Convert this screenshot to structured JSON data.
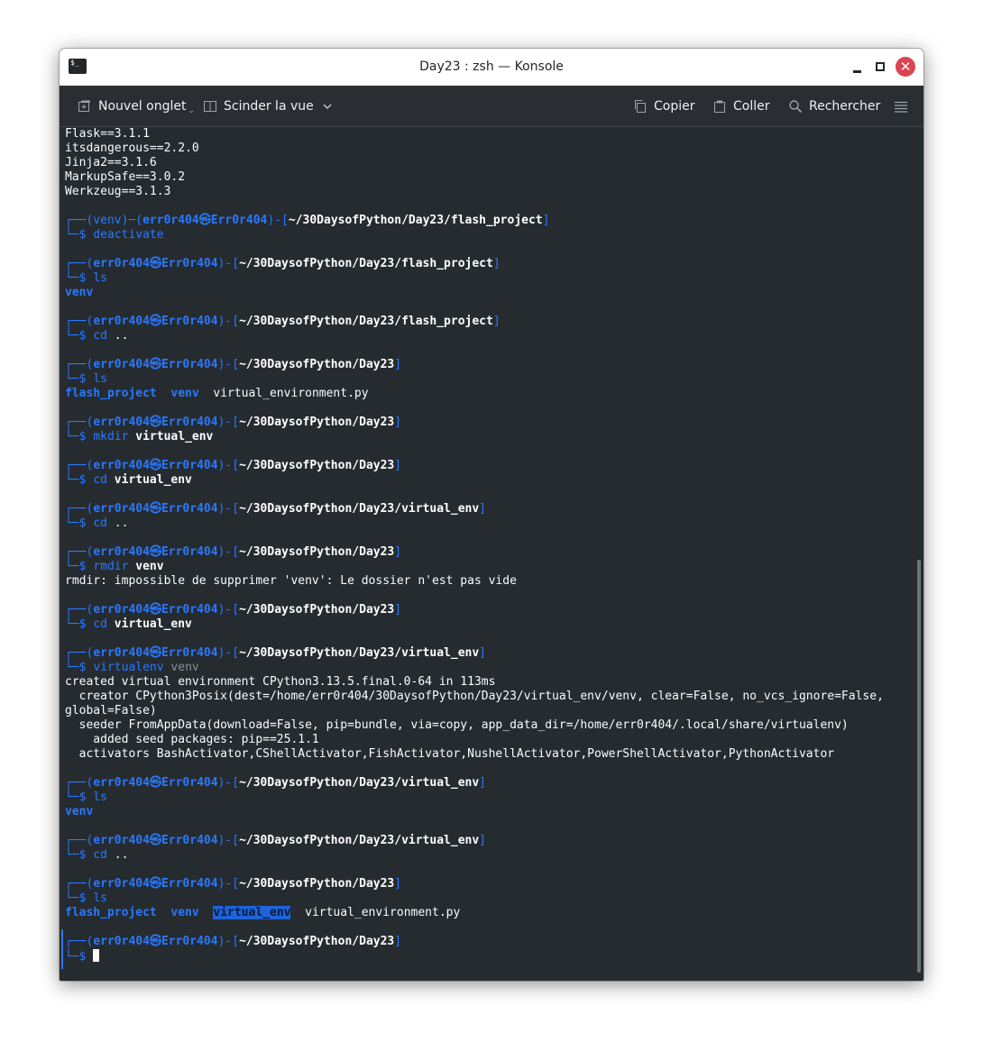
{
  "window": {
    "title": "Day23 : zsh — Konsole",
    "app_icon_glyph": "$_",
    "close_glyph": "✕"
  },
  "toolbar": {
    "new_tab": "Nouvel onglet",
    "split_view": "Scinder la vue",
    "copy": "Copier",
    "paste": "Coller",
    "search": "Rechercher",
    "icons": [
      "new-tab-icon",
      "split-view-icon",
      "chevron-down-icon",
      "copy-icon",
      "paste-icon",
      "search-icon",
      "hamburger-menu-icon"
    ]
  },
  "prompt": {
    "user": "err0r404",
    "at": "㉿",
    "host": "Err0r404",
    "venv_prefix": "(venv)"
  },
  "colors": {
    "prompt_blue": "#2979ff",
    "terminal_bg": "#262b30",
    "toolbar_bg": "#2a2e32",
    "close_red": "#da4453",
    "selection": "#1d63d9"
  },
  "terminal": {
    "lines": [
      "Flask==3.1.1",
      "itsdangerous==2.2.0",
      "Jinja2==3.1.6",
      "MarkupSafe==3.0.2",
      "Werkzeug==3.1.3",
      "",
      "┌──(venv)─(err0r404㉿Err0r404)-[~/30DaysofPython/Day23/flash_project]",
      "└─$ deactivate",
      "",
      "┌──(err0r404㉿Err0r404)-[~/30DaysofPython/Day23/flash_project]",
      "└─$ ls",
      "venv",
      "",
      "┌──(err0r404㉿Err0r404)-[~/30DaysofPython/Day23/flash_project]",
      "└─$ cd ..",
      "",
      "┌──(err0r404㉿Err0r404)-[~/30DaysofPython/Day23]",
      "└─$ ls",
      "flash_project  venv  virtual_environment.py",
      "",
      "┌──(err0r404㉿Err0r404)-[~/30DaysofPython/Day23]",
      "└─$ mkdir virtual_env",
      "",
      "┌──(err0r404㉿Err0r404)-[~/30DaysofPython/Day23]",
      "└─$ cd virtual_env",
      "",
      "┌──(err0r404㉿Err0r404)-[~/30DaysofPython/Day23/virtual_env]",
      "└─$ cd ..",
      "",
      "┌──(err0r404㉿Err0r404)-[~/30DaysofPython/Day23]",
      "└─$ rmdir venv",
      "rmdir: impossible de supprimer 'venv': Le dossier n'est pas vide",
      "",
      "┌──(err0r404㉿Err0r404)-[~/30DaysofPython/Day23]",
      "└─$ cd virtual_env",
      "",
      "┌──(err0r404㉿Err0r404)-[~/30DaysofPython/Day23/virtual_env]",
      "└─$ virtualenv venv",
      "created virtual environment CPython3.13.5.final.0-64 in 113ms",
      "  creator CPython3Posix(dest=/home/err0r404/30DaysofPython/Day23/virtual_env/venv, clear=False, no_vcs_ignore=False,",
      "global=False)",
      "  seeder FromAppData(download=False, pip=bundle, via=copy, app_data_dir=/home/err0r404/.local/share/virtualenv)",
      "    added seed packages: pip==25.1.1",
      "  activators BashActivator,CShellActivator,FishActivator,NushellActivator,PowerShellActivator,PythonActivator",
      "",
      "┌──(err0r404㉿Err0r404)-[~/30DaysofPython/Day23/virtual_env]",
      "└─$ ls",
      "venv",
      "",
      "┌──(err0r404㉿Err0r404)-[~/30DaysofPython/Day23/virtual_env]",
      "└─$ cd ..",
      "",
      "┌──(err0r404㉿Err0r404)-[~/30DaysofPython/Day23]",
      "└─$ ls",
      "flash_project  venv  virtual_env  virtual_environment.py",
      "",
      "┌──(err0r404㉿Err0r404)-[~/30DaysofPython/Day23]",
      "└─$ "
    ],
    "selected_text": "virtual_env"
  }
}
